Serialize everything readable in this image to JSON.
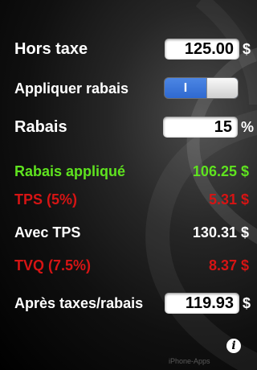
{
  "colors": {
    "green": "#5fe31f",
    "red": "#d61414",
    "switch_blue": "#3a76dc"
  },
  "rows": {
    "hors_taxe": {
      "label": "Hors taxe",
      "value": "125.00",
      "unit": "$"
    },
    "appliquer_rabais": {
      "label": "Appliquer rabais",
      "switch_on_text": "I",
      "state": "on"
    },
    "rabais": {
      "label": "Rabais",
      "value": "15",
      "unit": "%"
    },
    "rabais_applique": {
      "label": "Rabais appliqué",
      "value": "106.25 $"
    },
    "tps": {
      "label": "TPS (5%)",
      "value": "5.31 $"
    },
    "avec_tps": {
      "label": "Avec TPS",
      "value": "130.31 $"
    },
    "tvq": {
      "label": "TVQ (7.5%)",
      "value": "8.37 $"
    },
    "apres_taxes": {
      "label": "Après taxes/rabais",
      "value": "119.93",
      "unit": "$"
    }
  },
  "info_button": {
    "glyph": "i",
    "icon": "info-icon"
  },
  "watermark": "iPhone-Apps"
}
